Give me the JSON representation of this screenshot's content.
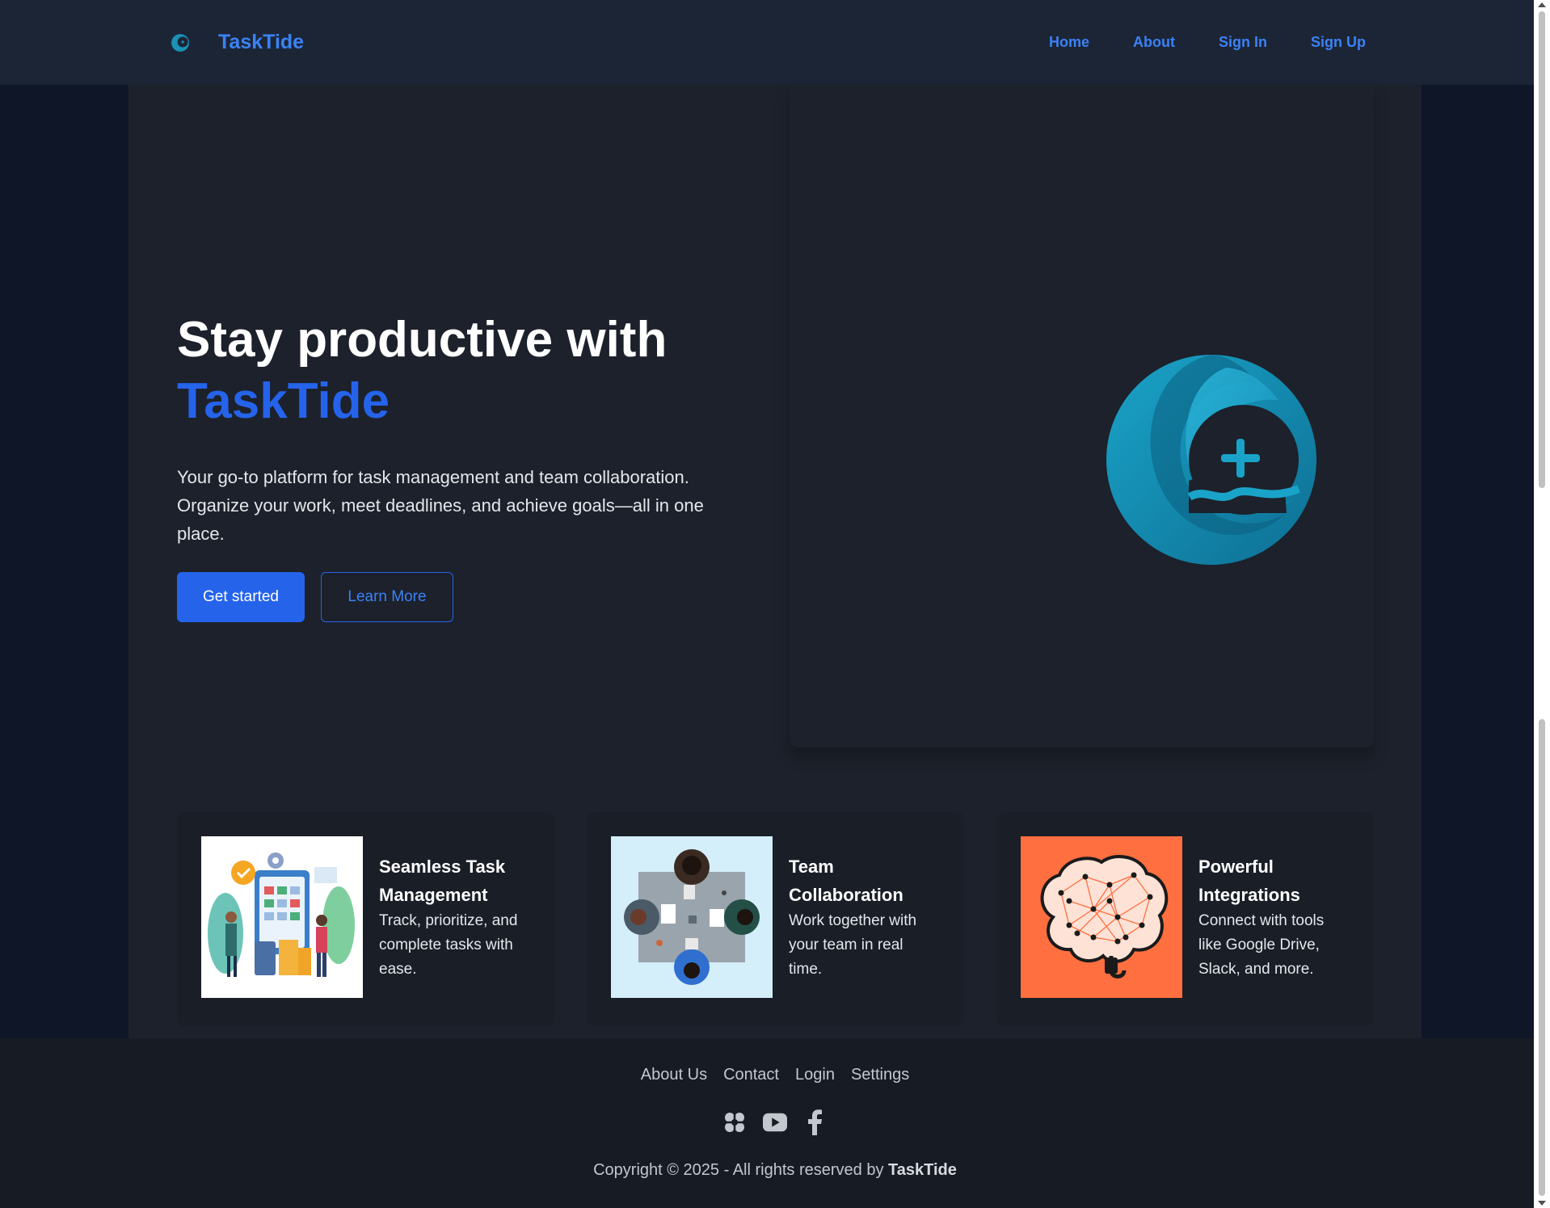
{
  "brand": {
    "name": "TaskTide",
    "logo_icon": "tasktide-wave-logo-icon"
  },
  "nav": {
    "items": [
      {
        "label": "Home"
      },
      {
        "label": "About"
      },
      {
        "label": "Sign In"
      },
      {
        "label": "Sign Up"
      }
    ]
  },
  "hero": {
    "title_line1": "Stay productive with",
    "title_accent": "TaskTide",
    "description": "Your go-to platform for task management and team collaboration. Organize your work, meet deadlines, and achieve goals—all in one place.",
    "primary_button": "Get started",
    "secondary_button": "Learn More"
  },
  "features": [
    {
      "title": "Seamless Task Management",
      "description": "Track, prioritize, and complete tasks with ease.",
      "image": "task-management-illustration"
    },
    {
      "title": "Team Collaboration",
      "description": "Work together with your team in real time.",
      "image": "team-meeting-illustration"
    },
    {
      "title": "Powerful Integrations",
      "description": "Connect with tools like Google Drive, Slack, and more.",
      "image": "brain-network-illustration"
    }
  ],
  "footer": {
    "links": [
      {
        "label": "About Us"
      },
      {
        "label": "Contact"
      },
      {
        "label": "Login"
      },
      {
        "label": "Settings"
      }
    ],
    "social": [
      "asterisk-icon",
      "youtube-icon",
      "facebook-icon"
    ],
    "copyright_prefix": "Copyright © 2025 - All rights reserved by ",
    "copyright_brand": "TaskTide"
  },
  "colors": {
    "accent": "#2563eb",
    "nav_bg": "#1c2536",
    "page_bg": "#0f1628",
    "main_bg": "#1c212b",
    "footer_bg": "#171b23"
  }
}
